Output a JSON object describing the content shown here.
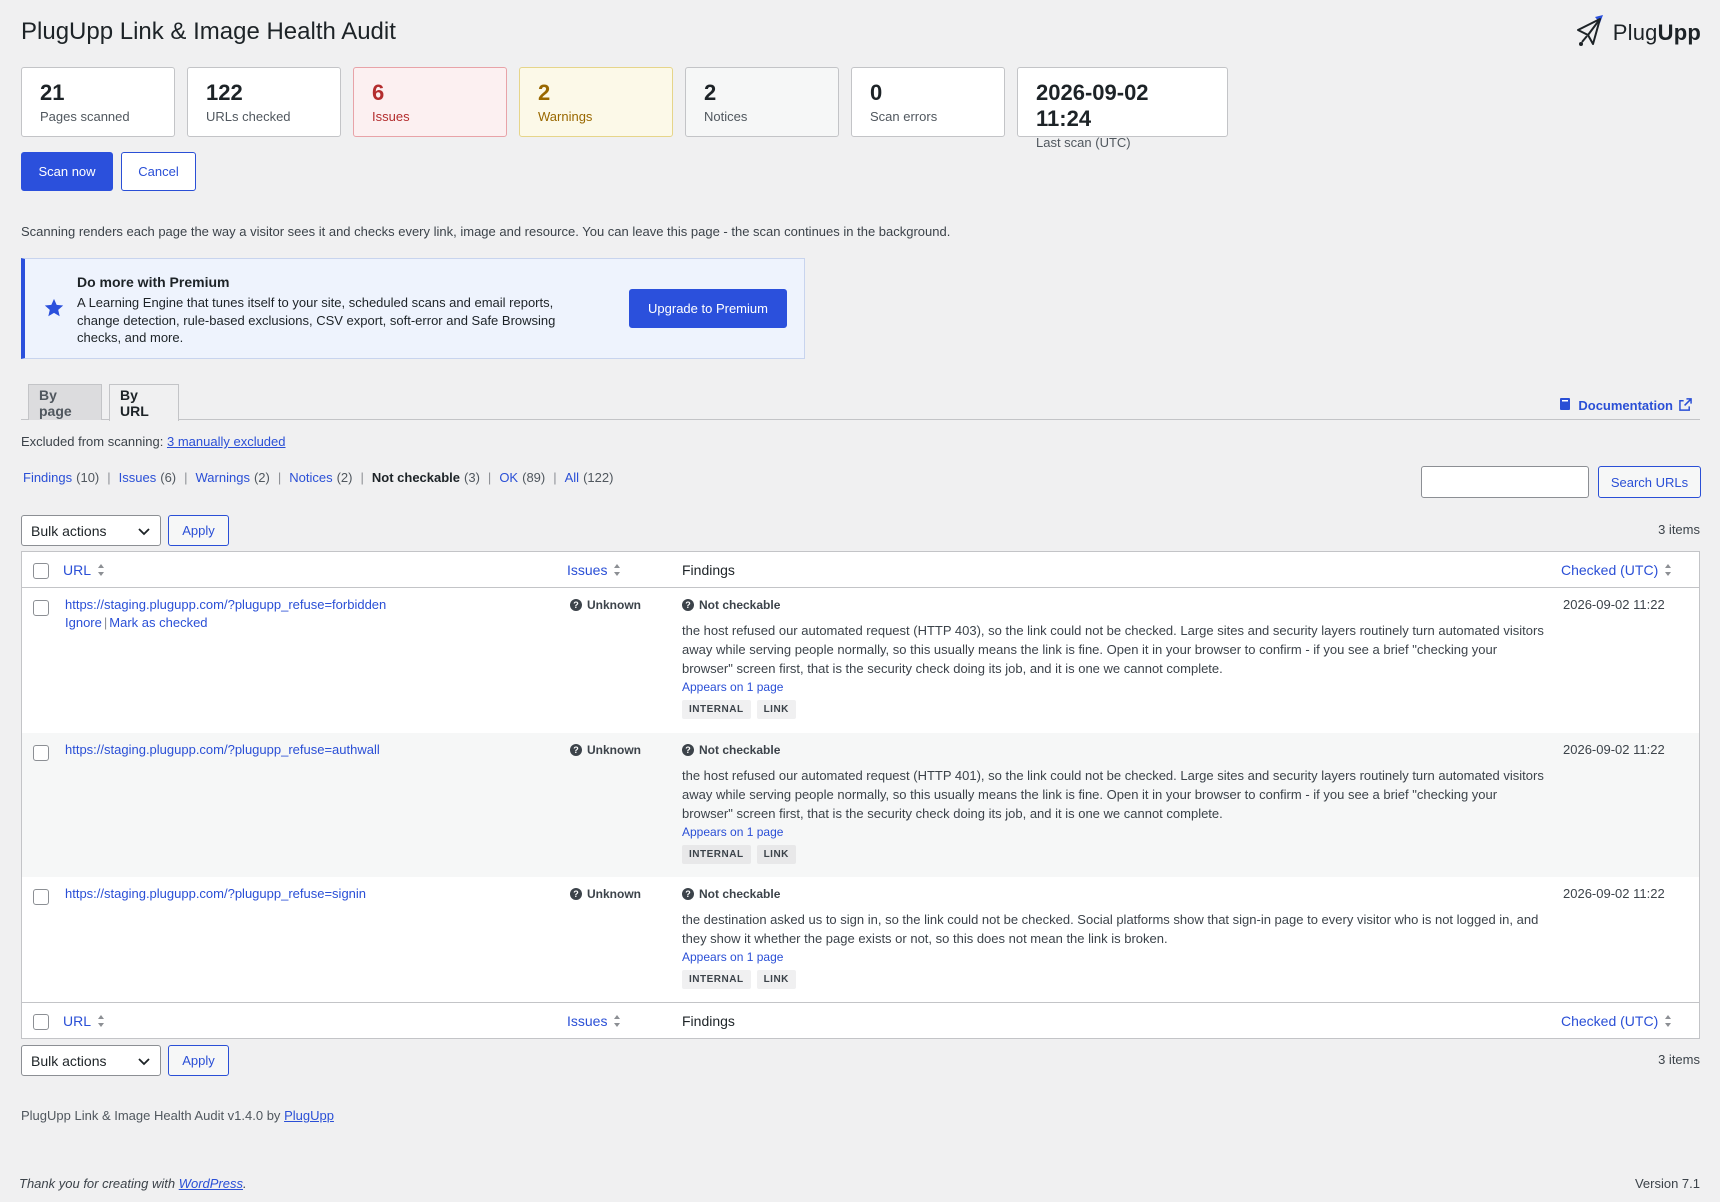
{
  "header": {
    "title": "PlugUpp Link & Image Health Audit",
    "brand_prefix": "Plug",
    "brand_suffix": "Upp"
  },
  "stats": [
    {
      "value": "21",
      "label": "Pages scanned"
    },
    {
      "value": "122",
      "label": "URLs checked"
    },
    {
      "value": "6",
      "label": "Issues"
    },
    {
      "value": "2",
      "label": "Warnings"
    },
    {
      "value": "2",
      "label": "Notices"
    },
    {
      "value": "0",
      "label": "Scan errors"
    },
    {
      "value": "2026-09-02 11:24",
      "label": "Last scan (UTC)"
    }
  ],
  "actions": {
    "scan_now": "Scan now",
    "cancel": "Cancel"
  },
  "scan_note": "Scanning renders each page the way a visitor sees it and checks every link, image and resource. You can leave this page - the scan continues in the background.",
  "premium": {
    "title": "Do more with Premium",
    "body": "A Learning Engine that tunes itself to your site, scheduled scans and email reports, change detection, rule-based exclusions, CSV export, soft-error and Safe Browsing checks, and more.",
    "button": "Upgrade to Premium",
    "accent": "#2b50dc"
  },
  "tabs": [
    {
      "label": "By page"
    },
    {
      "label": "By URL",
      "active": true
    }
  ],
  "documentation": "Documentation",
  "excluded": {
    "prefix": "Excluded from scanning:",
    "link": "3 manually excluded"
  },
  "filters": [
    {
      "label": "Findings",
      "count": "(10)"
    },
    {
      "label": "Issues",
      "count": "(6)"
    },
    {
      "label": "Warnings",
      "count": "(2)"
    },
    {
      "label": "Notices",
      "count": "(2)"
    },
    {
      "label": "Not checkable",
      "count": "(3)",
      "current": true
    },
    {
      "label": "OK",
      "count": "(89)"
    },
    {
      "label": "All",
      "count": "(122)"
    }
  ],
  "search": {
    "value": "",
    "button": "Search URLs"
  },
  "tablenav": {
    "bulk_actions": "Bulk actions",
    "apply": "Apply",
    "items": "3 items"
  },
  "columns": {
    "url": "URL",
    "issues": "Issues",
    "findings": "Findings",
    "checked": "Checked (UTC)"
  },
  "rows": [
    {
      "url": "https://staging.plugupp.com/?plugupp_refuse=forbidden",
      "actions": {
        "ignore": "Ignore",
        "mark": "Mark as checked"
      },
      "issue": "Unknown",
      "finding_status": "Not checkable",
      "finding_text": "the host refused our automated request (HTTP 403), so the link could not be checked. Large sites and security layers routinely turn automated visitors away while serving people normally, so this usually means the link is fine. Open it in your browser to confirm - if you see a brief \"checking your browser\" screen first, that is the security check doing its job, and it is one we cannot complete.",
      "appears": "Appears on 1 page",
      "tags": [
        "INTERNAL",
        "LINK"
      ],
      "checked": "2026-09-02 11:22"
    },
    {
      "url": "https://staging.plugupp.com/?plugupp_refuse=authwall",
      "issue": "Unknown",
      "finding_status": "Not checkable",
      "finding_text": "the host refused our automated request (HTTP 401), so the link could not be checked. Large sites and security layers routinely turn automated visitors away while serving people normally, so this usually means the link is fine. Open it in your browser to confirm - if you see a brief \"checking your browser\" screen first, that is the security check doing its job, and it is one we cannot complete.",
      "appears": "Appears on 1 page",
      "tags": [
        "INTERNAL",
        "LINK"
      ],
      "checked": "2026-09-02 11:22"
    },
    {
      "url": "https://staging.plugupp.com/?plugupp_refuse=signin",
      "issue": "Unknown",
      "finding_status": "Not checkable",
      "finding_text": "the destination asked us to sign in, so the link could not be checked. Social platforms show that sign-in page to every visitor who is not logged in, and they show it whether the page exists or not, so this does not mean the link is broken.",
      "appears": "Appears on 1 page",
      "tags": [
        "INTERNAL",
        "LINK"
      ],
      "checked": "2026-09-02 11:22"
    }
  ],
  "plugin_footer": {
    "text": "PlugUpp Link & Image Health Audit v1.4.0 by",
    "link": "PlugUpp"
  },
  "wp_footer": {
    "text": "Thank you for creating with",
    "link": "WordPress",
    "suffix": ".",
    "version": "Version 7.1"
  }
}
